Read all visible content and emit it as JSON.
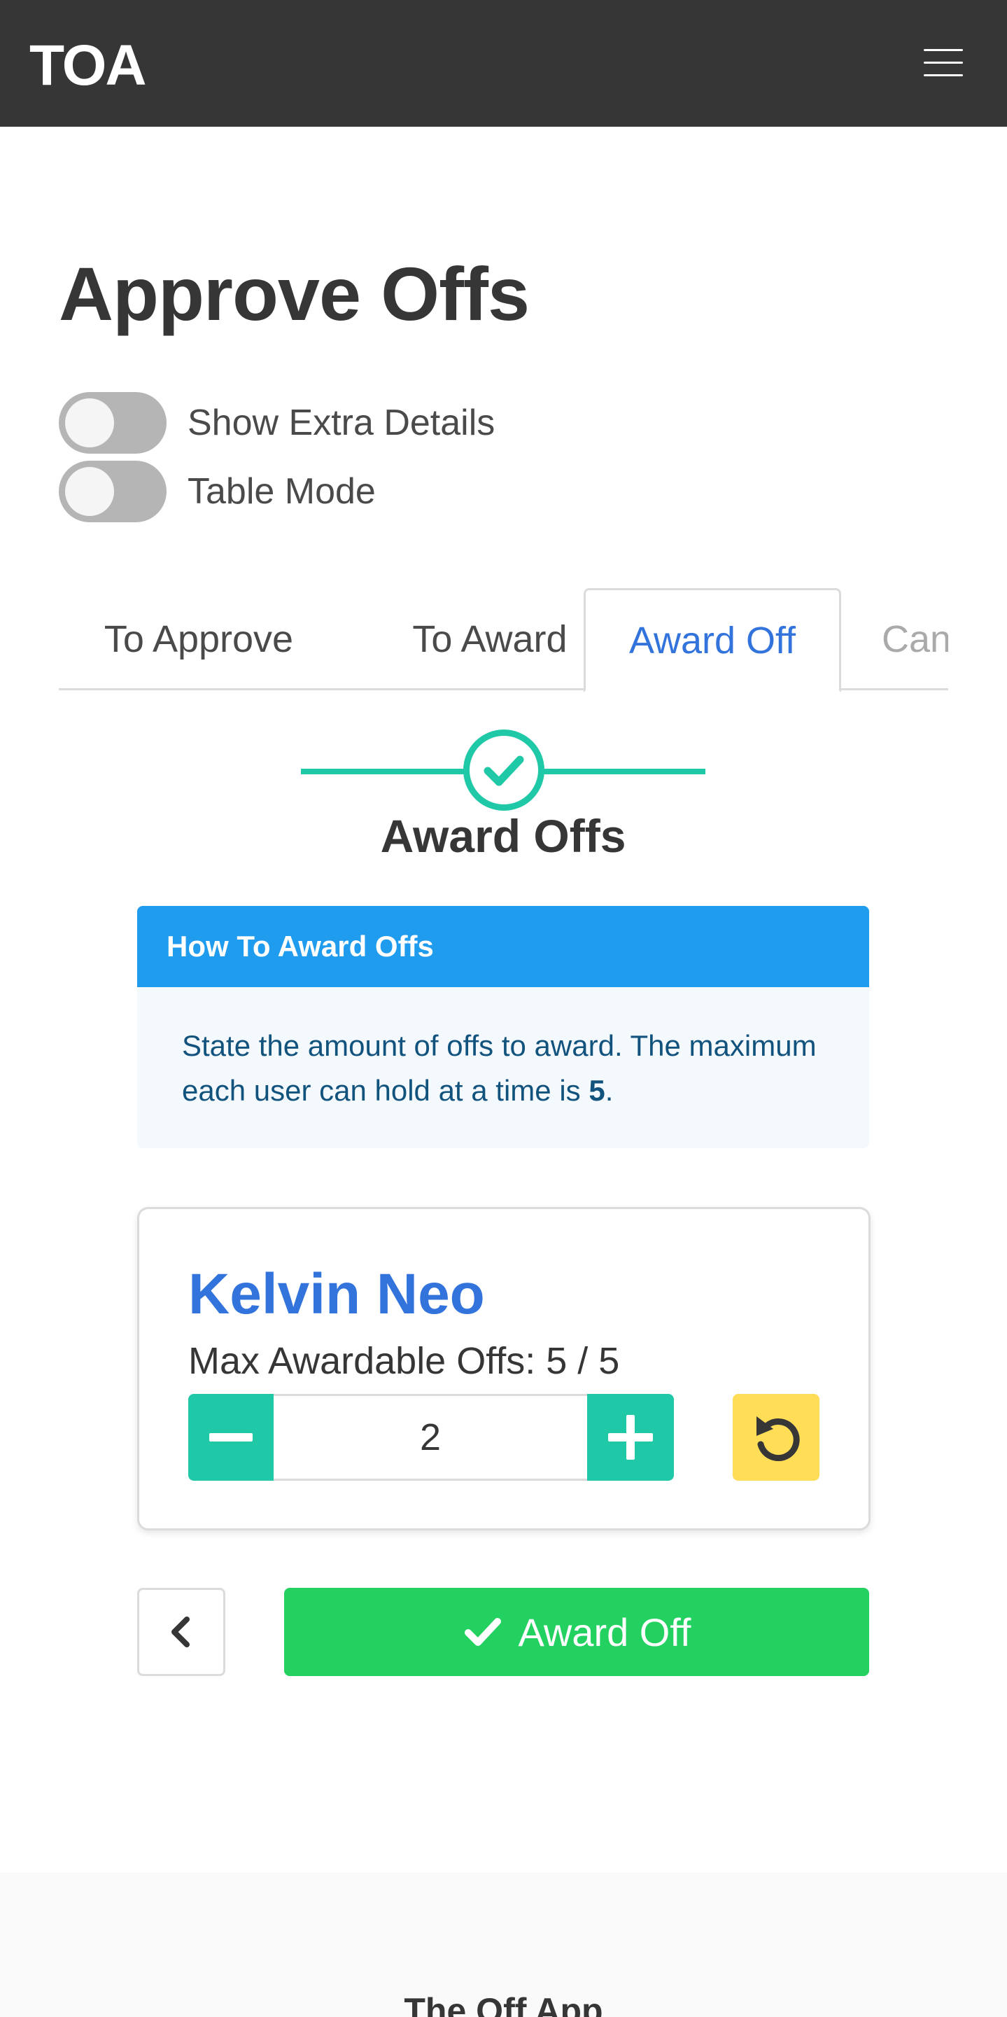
{
  "navbar": {
    "brand": "TOA",
    "menu_icon": "hamburger-icon"
  },
  "page": {
    "title": "Approve Offs"
  },
  "toggles": [
    {
      "label": "Show Extra Details",
      "on": false
    },
    {
      "label": "Table Mode",
      "on": false
    }
  ],
  "tabs": [
    {
      "label": "To Approve",
      "active": false
    },
    {
      "label": "To Award",
      "active": false
    },
    {
      "label": "Award Off",
      "active": true
    },
    {
      "label": "Can",
      "active": false
    }
  ],
  "steps": {
    "title": "Award Offs",
    "icon": "check-icon"
  },
  "info_message": {
    "header": "How To Award Offs",
    "body_text": "State the amount of offs to award. The maximum each user can hold at a time is ",
    "max_value": "5",
    "body_end": "."
  },
  "award_card": {
    "user_name": "Kelvin Neo",
    "max_awardable": "Max Awardable Offs: 5 / 5",
    "quantity": "2",
    "minus_icon": "minus-icon",
    "plus_icon": "plus-icon",
    "reset_icon": "undo-icon"
  },
  "actions": {
    "back_icon": "chevron-left-icon",
    "award_label": "Award Off",
    "award_icon": "check-icon"
  },
  "footer": {
    "title": "The Off App"
  },
  "colors": {
    "navbar": "#363636",
    "primary": "#1fc8a6",
    "link": "#3273dc",
    "info": "#209cee",
    "success": "#23d160",
    "warning": "#ffdd57"
  }
}
